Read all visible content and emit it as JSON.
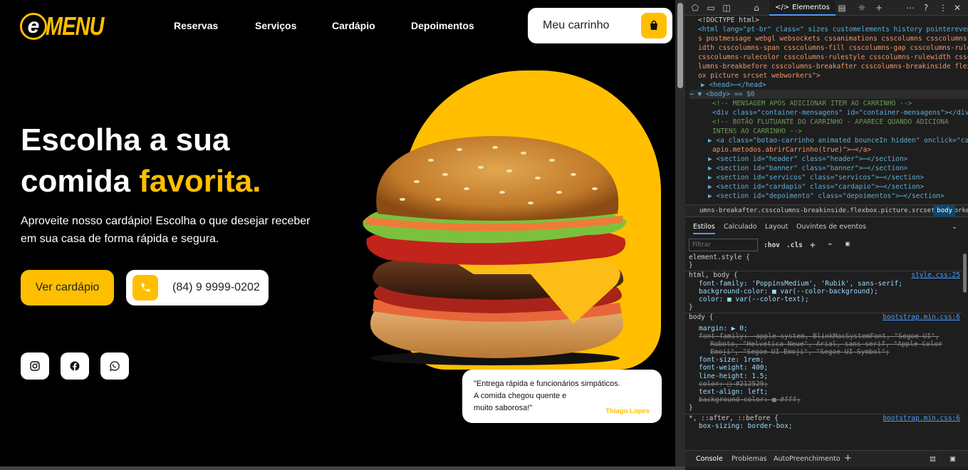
{
  "site": {
    "logo_e": "e",
    "logo_text": "MENU",
    "nav": [
      "Reservas",
      "Serviços",
      "Cardápio",
      "Depoimentos"
    ],
    "cart_label": "Meu carrinho",
    "hero_line1": "Escolha a sua",
    "hero_line2a": "comida ",
    "hero_line2b": "favorita.",
    "subtitle": "Aproveite nosso cardápio! Escolha o que desejar receber em sua casa de forma rápida e segura.",
    "btn_menu": "Ver cardápio",
    "phone": "(84) 9 9999-0202",
    "social": [
      "instagram-icon",
      "facebook-icon",
      "whatsapp-icon"
    ],
    "testimonial": {
      "quote_l1": "\"Entrega rápida e funcionários simpáticos.",
      "quote_l2": "A comida chegou quente e",
      "quote_l3": "muito saborosa!\"",
      "author": "Thiago Lopes"
    },
    "accent": "#ffbf00"
  },
  "devtools": {
    "active_tab": "Elementos",
    "code_lines": [
      "<!DOCTYPE html>",
      "<html lang=\"pt-br\" class=\" sizes customelements history pointerevent",
      "s postmessage webgl websockets cssanimations csscolumns csscolumns-w",
      "idth csscolumns-span csscolumns-fill csscolumns-gap csscolumns-rule",
      "csscolumns-rulecolor csscolumns-rulestyle csscolumns-rulewidth cssco",
      "lumns-breakbefore csscolumns-breakafter csscolumns-breakinside flexb",
      "ox picture srcset webworkers\">",
      "▶ <head>⋯</head>",
      "⋯ ▼ <body> == $0",
      "<!-- MENSAGEM APÓS ADICIONAR ITEM AO CARRINHO -->",
      "<div class=\"container-mensagens\" id=\"container-mensagens\"></div>",
      "<!-- BOTÃO FLUTUANTE DO CARRINHO - APARECE QUANDO ADICIONA",
      "INTENS AO CARRINHO -->",
      "▶ <a class=\"botao-carrinho animated bounceIn hidden\" onclick=\"card",
      "apio.metodos.abrirCarrinho(true)\">⋯</a>",
      "▶ <section id=\"header\" class=\"header\">⋯</section>",
      "▶ <section id=\"banner\" class=\"banner\">⋯</section>",
      "▶ <section id=\"servicos\" class=\"servicos\">⋯</section>",
      "▶ <section id=\"cardapio\" class=\"cardapio\">⋯</section>",
      "▶ <section id=\"depoimento\" class=\"depoimentos\">⋯</section>"
    ],
    "breadcrumb": "umns-breakafter.csscolumns-breakinside.flexbox.picture.srcset.webworkers",
    "breadcrumb_selected": "body",
    "subtabs": [
      "Estilos",
      "Calculado",
      "Layout",
      "Ouvintes de eventos"
    ],
    "filter_placeholder": "Filtrar",
    "hov": ":hov",
    "cls": ".cls",
    "styles_lines": [
      "element.style {",
      "}",
      "html, body {",
      "font-family: 'PoppinsMedium', 'Rubik', sans-serif;",
      "background-color: ■ var(--color-background);",
      "color: ■ var(--color-text);",
      "}",
      "body {",
      "margin: ▶ 0;",
      "font-family: -apple-system, BlinkMacSystemFont, \"Segoe UI\",",
      "Roboto, \"Helvetica Neue\", Arial, sans-serif, \"Apple Color",
      "Emoji\", \"Segoe UI Emoji\", \"Segoe UI Symbol\";",
      "font-size: 1rem;",
      "font-weight: 400;",
      "line-height: 1.5;",
      "color: □ #212529;",
      "text-align: left;",
      "background-color: ■ #fff;",
      "}",
      "*, ::after, ::before {",
      "box-sizing: border-box;"
    ],
    "sources": [
      "style.css:25",
      "bootstrap.min.css:6",
      "bootstrap.min.css:6"
    ],
    "bottom_tabs": [
      "Console",
      "Problemas",
      "AutoPreenchimento"
    ]
  }
}
